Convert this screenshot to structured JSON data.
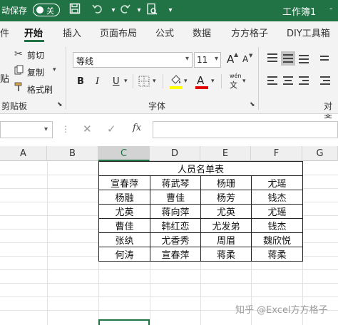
{
  "titlebar": {
    "autosave_label": "动保存",
    "toggle_text": "关",
    "save_icon": "save-icon",
    "workbook_title": "工作簿1",
    "title_arrow": "-"
  },
  "tabs": [
    {
      "label": "件"
    },
    {
      "label": "开始"
    },
    {
      "label": "插入"
    },
    {
      "label": "页面布局"
    },
    {
      "label": "公式"
    },
    {
      "label": "数据"
    },
    {
      "label": "方方格子"
    },
    {
      "label": "DIY工具箱"
    }
  ],
  "ribbon": {
    "clipboard": {
      "paste_partial": "贴",
      "cut": "剪切",
      "copy": "复制",
      "format_painter": "格式刷",
      "group_label": "剪贴板"
    },
    "font": {
      "name": "等线",
      "size": "11",
      "grow": "A",
      "shrink": "A",
      "bold": "B",
      "italic": "I",
      "underline": "U",
      "phonetic_top": "wén",
      "phonetic_bottom": "文",
      "font_color_letter": "A",
      "highlight_color": "#ffff00",
      "font_color": "#e00000",
      "group_label": "字体"
    },
    "alignment": {
      "group_label_partial": "对齐"
    }
  },
  "formula_bar": {
    "fx": "fx",
    "value": ""
  },
  "columns": [
    "A",
    "B",
    "C",
    "D",
    "E",
    "F",
    "G"
  ],
  "selected_column": "C",
  "table": {
    "title": "人员名单表",
    "rows": [
      [
        "宣春萍",
        "蒋武琴",
        "杨珊",
        "尤瑶"
      ],
      [
        "杨融",
        "曹佳",
        "杨芳",
        "钱杰"
      ],
      [
        "尤英",
        "蒋向萍",
        "尤英",
        "尤瑶"
      ],
      [
        "曹佳",
        "韩红恋",
        "尤发弟",
        "钱杰"
      ],
      [
        "张纨",
        "尤香秀",
        "周眉",
        "魏欣悦"
      ],
      [
        "何涛",
        "宣春萍",
        "蒋柔",
        "蒋柔"
      ]
    ]
  },
  "watermark": "知乎 @Excel方方格子"
}
